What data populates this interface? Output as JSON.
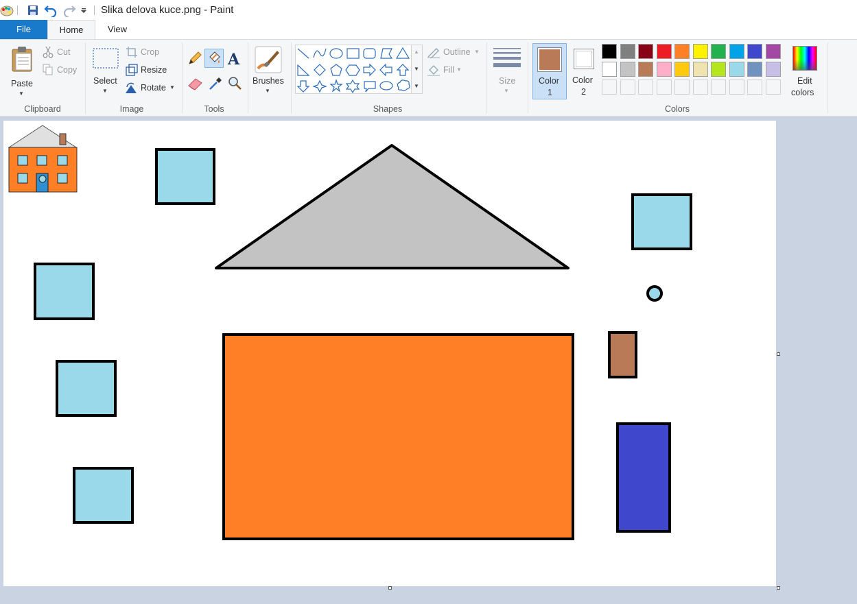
{
  "window": {
    "title": "Slika delova kuce.png - Paint"
  },
  "tabs": [
    {
      "label": "File"
    },
    {
      "label": "Home"
    },
    {
      "label": "View"
    }
  ],
  "ribbon": {
    "clipboard": {
      "paste": "Paste",
      "cut": "Cut",
      "copy": "Copy",
      "group": "Clipboard"
    },
    "image": {
      "select": "Select",
      "crop": "Crop",
      "resize": "Resize",
      "rotate": "Rotate",
      "group": "Image"
    },
    "tools": {
      "group": "Tools"
    },
    "brushes": {
      "label": "Brushes"
    },
    "shapes": {
      "outline": "Outline",
      "fill": "Fill",
      "group": "Shapes"
    },
    "size": {
      "label": "Size"
    },
    "colors": {
      "color1_line1": "Color",
      "color1_line2": "1",
      "color2_line1": "Color",
      "color2_line2": "2",
      "edit_line1": "Edit",
      "edit_line2": "colors",
      "group": "Colors",
      "color1_value": "#b97a57",
      "color2_value": "#ffffff",
      "palette_row1": [
        "#000000",
        "#7f7f7f",
        "#880015",
        "#ed1c24",
        "#ff7f27",
        "#fff200",
        "#22b14c",
        "#00a2e8",
        "#3f48cc",
        "#a349a4"
      ],
      "palette_row2": [
        "#ffffff",
        "#c3c3c3",
        "#b97a57",
        "#ffaec9",
        "#ffc90e",
        "#efe4b0",
        "#b5e61d",
        "#99d9ea",
        "#7092be",
        "#c8bfe7"
      ]
    }
  },
  "drawing": {
    "colors": {
      "window": "#99d9ea",
      "roof": "#c3c3c3",
      "wall": "#ff7f27",
      "chimney": "#b97a57",
      "door": "#3f48cc",
      "outline": "#000000"
    }
  }
}
